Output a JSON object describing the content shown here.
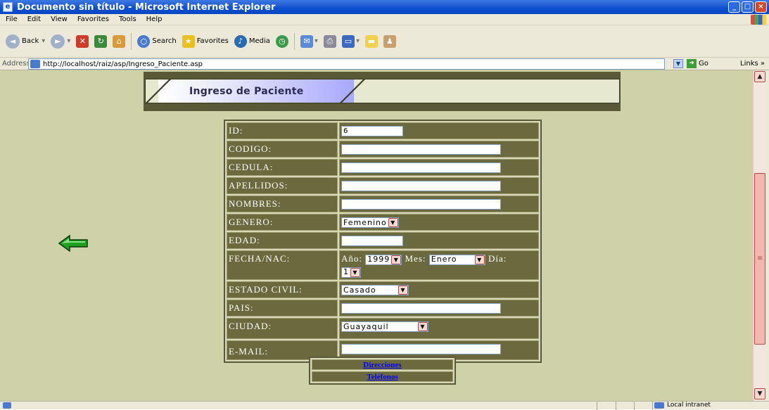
{
  "window": {
    "title": "Documento sin título - Microsoft Internet Explorer"
  },
  "menu": [
    "File",
    "Edit",
    "View",
    "Favorites",
    "Tools",
    "Help"
  ],
  "toolbar": {
    "back": "Back",
    "search": "Search",
    "favorites": "Favorites",
    "media": "Media"
  },
  "address": {
    "label": "Address",
    "url": "http://localhost/raiz/asp/Ingreso_Paciente.asp",
    "go": "Go",
    "links": "Links"
  },
  "status": {
    "zone": "Local intranet"
  },
  "page": {
    "header_title": "Ingreso de Paciente",
    "form": {
      "id_label": "ID:",
      "id_value": "6",
      "codigo_label": "CODIGO:",
      "codigo_value": "",
      "cedula_label": "CEDULA:",
      "cedula_value": "",
      "apellidos_label": "APELLIDOS:",
      "apellidos_value": "",
      "nombres_label": "NOMBRES:",
      "nombres_value": "",
      "genero_label": "GENERO:",
      "genero_value": "Femenino",
      "edad_label": "EDAD:",
      "edad_value": "",
      "fecha_label": "FECHA/NAC:",
      "anio_label": "Año:",
      "anio_value": "1999",
      "mes_label": "Mes:",
      "mes_value": "Enero",
      "dia_label": "Día:",
      "dia_value": "1",
      "estado_label": "ESTADO CIVIL:",
      "estado_value": "Casado",
      "pais_label": "PAIS:",
      "pais_value": "",
      "ciudad_label": "CIUDAD:",
      "ciudad_value": "Guayaquil",
      "email_label": "E-MAIL:",
      "email_value": ""
    },
    "links": {
      "direcciones": "Direcciones",
      "telefonos": "Teléfonos"
    }
  },
  "colors": {
    "page_bg": "#cfd1a8",
    "cell_bg": "#6b6a3e",
    "header_band": "#5a5937",
    "title_bar": "#0b4fd0"
  },
  "icons": [
    "ie-icon",
    "back-arrow-icon",
    "forward-arrow-icon",
    "stop-icon",
    "refresh-icon",
    "home-icon",
    "search-icon",
    "favorites-star-icon",
    "media-icon",
    "history-icon",
    "mail-icon",
    "print-icon",
    "edit-icon",
    "messenger-icon",
    "go-arrow-icon",
    "page-back-green-arrow-icon"
  ]
}
